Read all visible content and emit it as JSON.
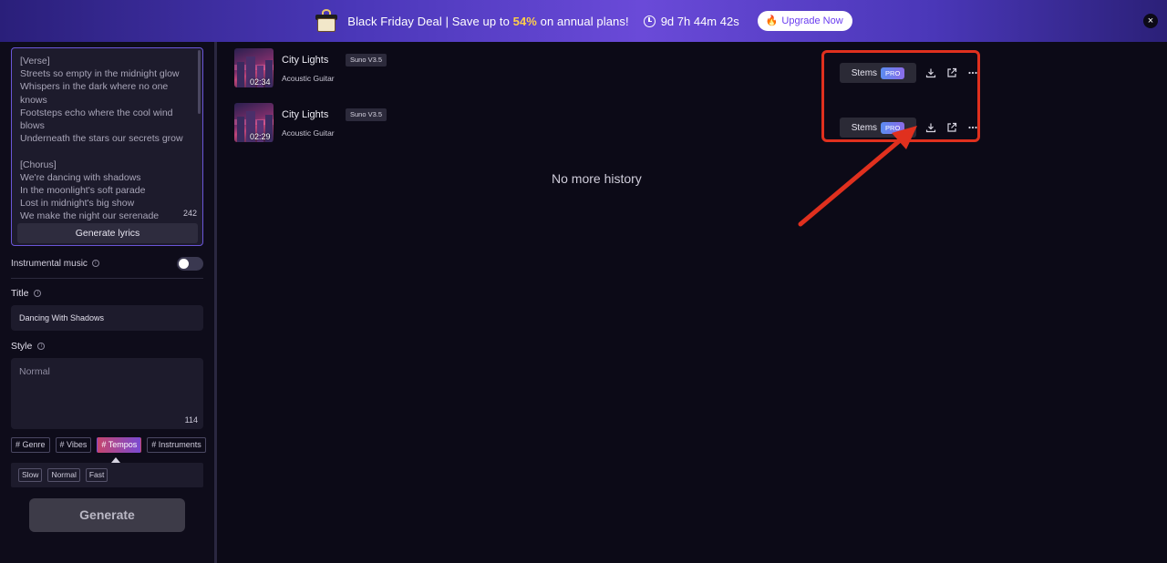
{
  "banner": {
    "deal_prefix": "Black Friday Deal | Save up to ",
    "deal_percent": "54%",
    "deal_suffix": " on annual plans!",
    "countdown": "9d 7h 44m 42s",
    "upgrade_label": "Upgrade Now",
    "close_symbol": "×"
  },
  "sidebar": {
    "lyrics_lines": [
      "[Verse]",
      "Streets so empty in the midnight glow",
      "Whispers in the dark where no one",
      "knows",
      "Footsteps echo where the cool wind",
      "blows",
      "Underneath the stars our secrets grow",
      "",
      "[Chorus]",
      "We're dancing with shadows",
      "In the moonlight's soft parade",
      "Lost in midnight's big show",
      "We make the night our serenade"
    ],
    "lyrics_count": "242",
    "generate_lyrics_label": "Generate lyrics",
    "instrumental_label": "Instrumental music",
    "instrumental_on": false,
    "title_label": "Title",
    "title_value": "Dancing With Shadows",
    "style_label": "Style",
    "style_placeholder": "Normal",
    "style_count": "114",
    "tags": [
      {
        "label": "# Genre",
        "active": false
      },
      {
        "label": "# Vibes",
        "active": false
      },
      {
        "label": "# Tempos",
        "active": true
      },
      {
        "label": "# Instruments",
        "active": false
      }
    ],
    "tempo_options": [
      "Slow",
      "Normal",
      "Fast"
    ],
    "generate_label": "Generate"
  },
  "songs": [
    {
      "title": "City Lights",
      "version": "Suno V3.5",
      "subtitle": "Acoustic Guitar",
      "duration": "02:34",
      "stems_label": "Stems",
      "pro_label": "PRO"
    },
    {
      "title": "City Lights",
      "version": "Suno V3.5",
      "subtitle": "Acoustic Guitar",
      "duration": "02:29",
      "stems_label": "Stems",
      "pro_label": "PRO"
    }
  ],
  "no_history_text": "No more history",
  "colors": {
    "accent": "#6a56d8",
    "highlight": "#e0301e",
    "background": "#0c0a17"
  }
}
